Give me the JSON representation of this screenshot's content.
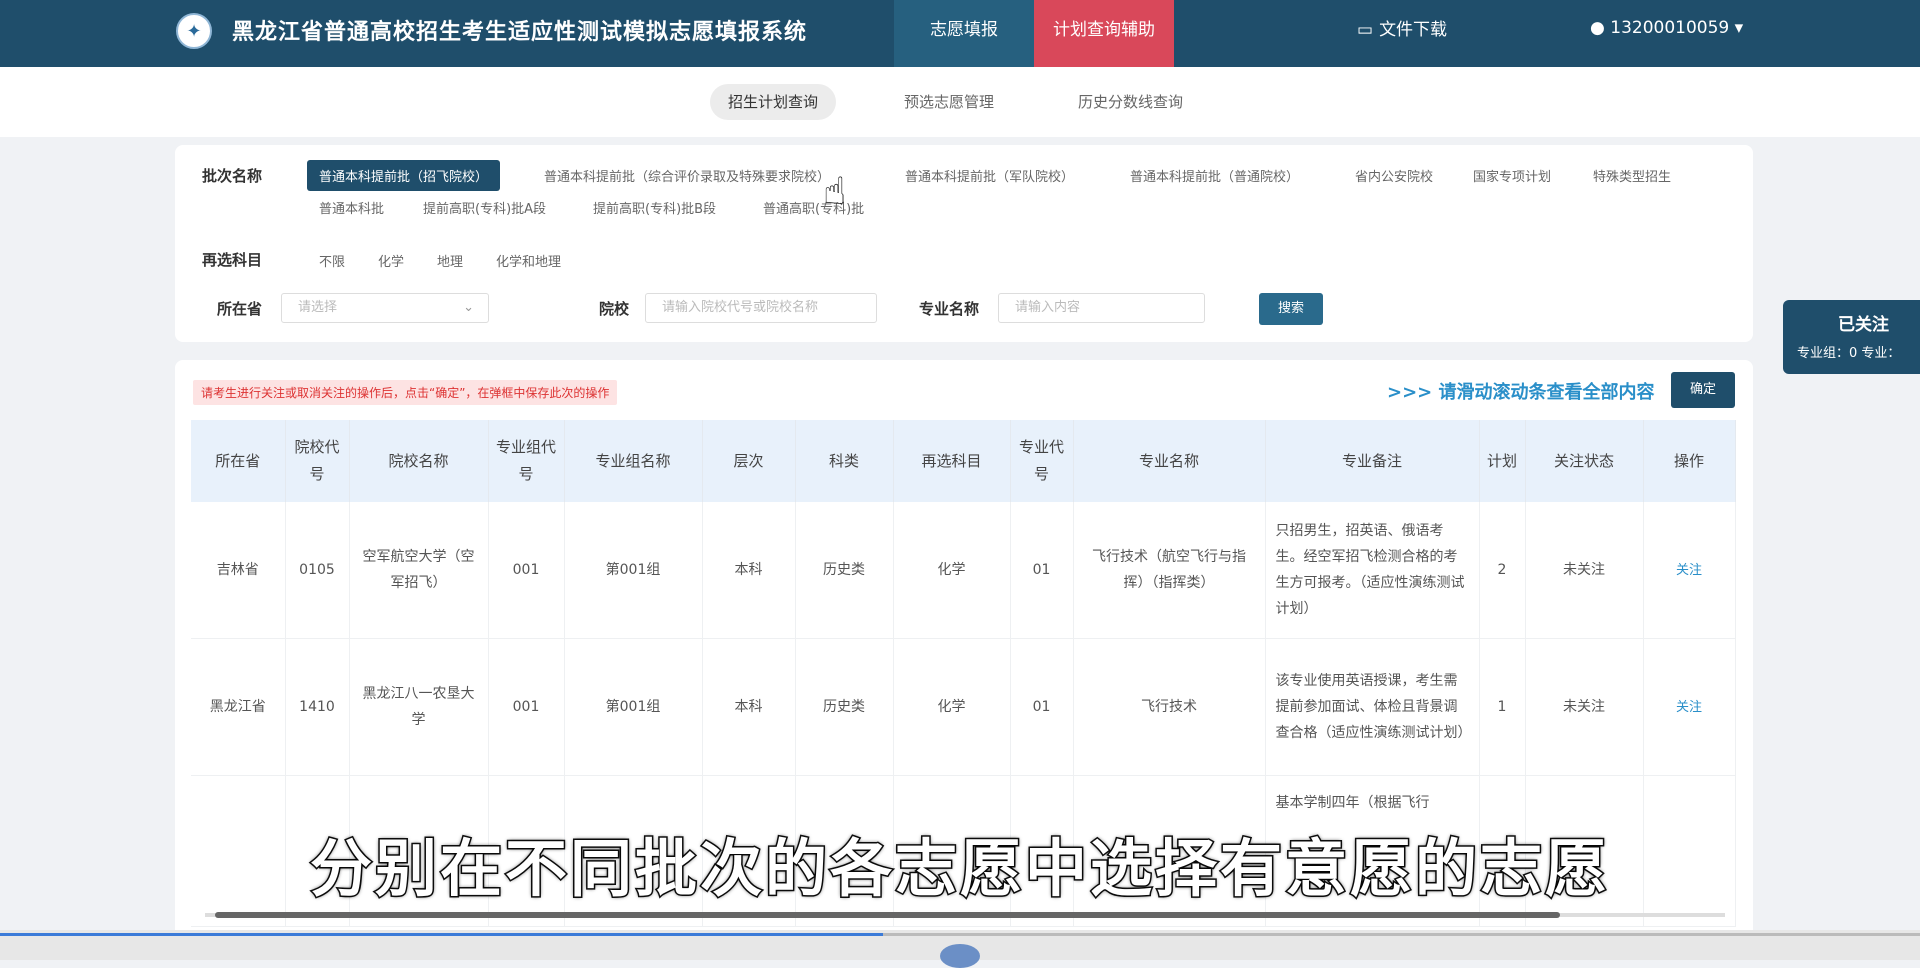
{
  "header": {
    "title": "黑龙江省普通高校招生考生适应性测试模拟志愿填报系统",
    "tabs": [
      "志愿填报",
      "计划查询辅助"
    ],
    "download": "文件下载",
    "user": "13200010059"
  },
  "subnav": [
    "招生计划查询",
    "预选志愿管理",
    "历史分数线查询"
  ],
  "filter": {
    "batch_label": "批次名称",
    "batch_options": [
      "普通本科提前批（招飞院校）",
      "普通本科提前批（综合评价录取及特殊要求院校）",
      "普通本科提前批（军队院校）",
      "普通本科提前批（普通院校）",
      "省内公安院校",
      "国家专项计划",
      "特殊类型招生",
      "普通本科批",
      "提前高职(专科)批A段",
      "提前高职(专科)批B段",
      "普通高职(专科)批"
    ],
    "subject_label": "再选科目",
    "subject_options": [
      "不限",
      "化学",
      "地理",
      "化学和地理"
    ],
    "province_label": "所在省",
    "province_placeholder": "请选择",
    "school_label": "院校",
    "school_placeholder": "请输入院校代号或院校名称",
    "major_label": "专业名称",
    "major_placeholder": "请输入内容",
    "search_btn": "搜索"
  },
  "follow": {
    "title": "已关注",
    "stats": "专业组：0 专业："
  },
  "table_card": {
    "notice": "请考生进行关注或取消关注的操作后，点击“确定”，在弹框中保存此次的操作",
    "scroll_hint": ">>> 请滑动滚动条查看全部内容",
    "ok_btn": "确定",
    "columns": [
      "所在省",
      "院校代号",
      "院校名称",
      "专业组代号",
      "专业组名称",
      "层次",
      "科类",
      "再选科目",
      "专业代号",
      "专业名称",
      "专业备注",
      "计划",
      "关注状态",
      "操作"
    ],
    "rows": [
      [
        "吉林省",
        "0105",
        "空军航空大学（空军招飞）",
        "001",
        "第001组",
        "本科",
        "历史类",
        "化学",
        "01",
        "飞行技术（航空飞行与指挥）（指挥类）",
        "只招男生，招英语、俄语考生。经空军招飞检测合格的考生方可报考。（适应性演练测试计划）",
        "2",
        "未关注",
        "关注"
      ],
      [
        "黑龙江省",
        "1410",
        "黑龙江八一农垦大学",
        "001",
        "第001组",
        "本科",
        "历史类",
        "化学",
        "01",
        "飞行技术",
        "该专业使用英语授课，考生需提前参加面试、体检且背景调查合格（适应性演练测试计划）",
        "1",
        "未关注",
        "关注"
      ],
      [
        "",
        "",
        "",
        "",
        "",
        "",
        "",
        "",
        "",
        "",
        "基本学制四年（根据飞行",
        "",
        "",
        ""
      ]
    ]
  },
  "subtitle": "分别在不同批次的各志愿中选择有意愿的志愿",
  "video_progress": 0.46
}
